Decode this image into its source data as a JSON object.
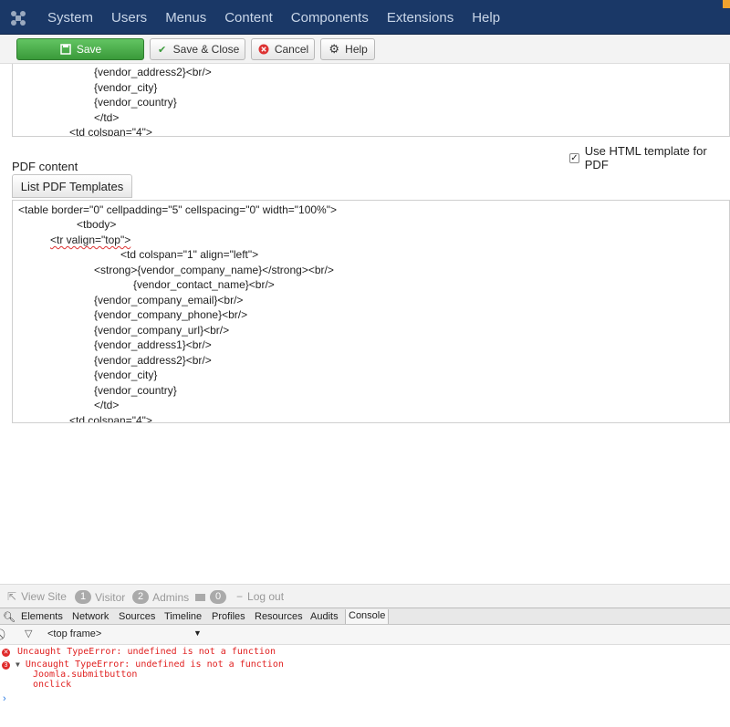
{
  "nav": {
    "items": [
      "System",
      "Users",
      "Menus",
      "Content",
      "Components",
      "Extensions",
      "Help"
    ]
  },
  "toolbar": {
    "save": "Save",
    "save_close": "Save & Close",
    "cancel": "Cancel",
    "help": "Help"
  },
  "editor1": {
    "lines": [
      "{vendor_address2}<br/>",
      "{vendor_city}",
      "{vendor_country}",
      "</td>",
      "<td colspan=\"4\">"
    ]
  },
  "checkbox": {
    "label": "Use HTML template for PDF",
    "checked": true
  },
  "pdf": {
    "label": "PDF content",
    "list_button": "List PDF Templates",
    "lines": [
      "<table border=\"0\" cellpadding=\"5\" cellspacing=\"0\" width=\"100%\">",
      "<tbody>",
      "<tr valign=\"top\">",
      "<td colspan=\"1\" align=\"left\">",
      "<strong>{vendor_company_name}</strong><br/>",
      "{vendor_contact_name}<br/>",
      "{vendor_company_email}<br/>",
      "{vendor_company_phone}<br/>",
      "{vendor_company_url}<br/>",
      "{vendor_address1}<br/>",
      "{vendor_address2}<br/>",
      "{vendor_city}",
      "{vendor_country}",
      "</td>",
      "<td colspan=\"4\">"
    ]
  },
  "status": {
    "view_site": "View Site",
    "visitor_count": "1",
    "visitor": "Visitor",
    "admins_count": "2",
    "admins": "Admins",
    "messages_count": "0",
    "logout": "Log out"
  },
  "devtools": {
    "tabs": [
      "Elements",
      "Network",
      "Sources",
      "Timeline",
      "Profiles",
      "Resources",
      "Audits",
      "Console"
    ],
    "frame": "<top frame>",
    "errors": {
      "error1": "Uncaught TypeError: undefined is not a function",
      "error2_count": "3",
      "error2": "Uncaught TypeError: undefined is not a function",
      "trace1": "Joomla.submitbutton",
      "trace2": "onclick"
    }
  }
}
